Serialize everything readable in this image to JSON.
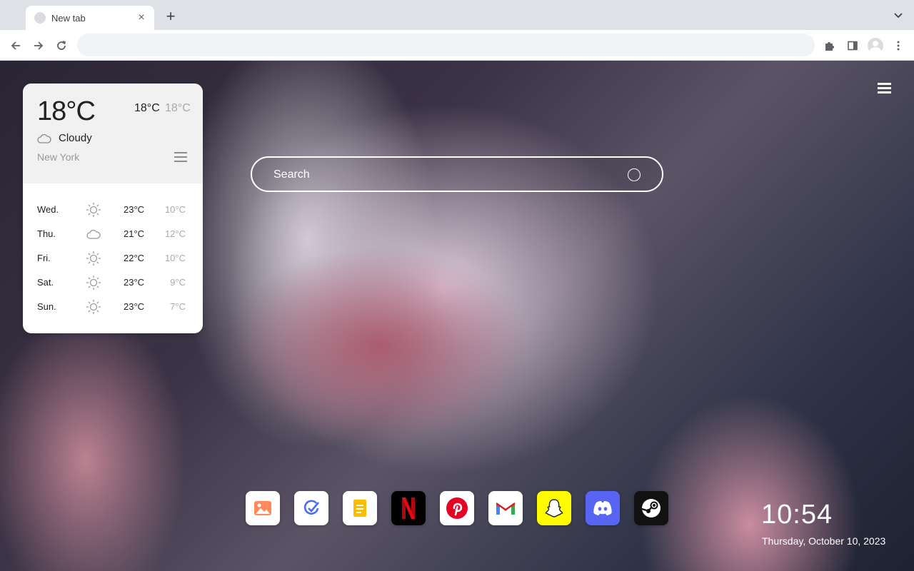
{
  "browser": {
    "tab": {
      "title": "New tab",
      "close_glyph": "×",
      "favicon": "globe-icon"
    },
    "new_tab_glyph": "+",
    "toolbar": {
      "back": "arrow-left-icon",
      "forward": "arrow-right-icon",
      "reload": "reload-icon",
      "extensions": "puzzle-icon",
      "side_panel": "side-panel-icon",
      "profile": "avatar-icon",
      "menu": "kebab-icon"
    },
    "omnibox": {
      "value": "",
      "placeholder": ""
    }
  },
  "weather": {
    "current_temp": "18°C",
    "high": "18°C",
    "low": "18°C",
    "condition": "Cloudy",
    "condition_icon": "cloud-icon",
    "city": "New York",
    "forecast": [
      {
        "day": "Wed.",
        "icon": "sun-icon",
        "high": "23°C",
        "low": "10°C"
      },
      {
        "day": "Thu.",
        "icon": "cloud-icon",
        "high": "21°C",
        "low": "12°C"
      },
      {
        "day": "Fri.",
        "icon": "sun-icon",
        "high": "22°C",
        "low": "10°C"
      },
      {
        "day": "Sat.",
        "icon": "sun-icon",
        "high": "23°C",
        "low": "9°C"
      },
      {
        "day": "Sun.",
        "icon": "sun-icon",
        "high": "23°C",
        "low": "7°C"
      }
    ]
  },
  "search": {
    "placeholder": "Search",
    "icon": "search-icon"
  },
  "dock": [
    {
      "name": "photos",
      "icon": "photo-icon",
      "bg": "#ffffff"
    },
    {
      "name": "tasks",
      "icon": "check-icon",
      "bg": "#ffffff"
    },
    {
      "name": "notes",
      "icon": "note-icon",
      "bg": "#ffffff"
    },
    {
      "name": "netflix",
      "icon": "netflix-icon",
      "bg": "#000000"
    },
    {
      "name": "pinterest",
      "icon": "pinterest-icon",
      "bg": "#ffffff"
    },
    {
      "name": "gmail",
      "icon": "gmail-icon",
      "bg": "#ffffff"
    },
    {
      "name": "snapchat",
      "icon": "snapchat-icon",
      "bg": "#fffc00"
    },
    {
      "name": "discord",
      "icon": "discord-icon",
      "bg": "#5865f2"
    },
    {
      "name": "steam",
      "icon": "steam-icon",
      "bg": "#111111"
    }
  ],
  "clock": {
    "time": "10:54",
    "date": "Thursday, October 10, 2023"
  }
}
